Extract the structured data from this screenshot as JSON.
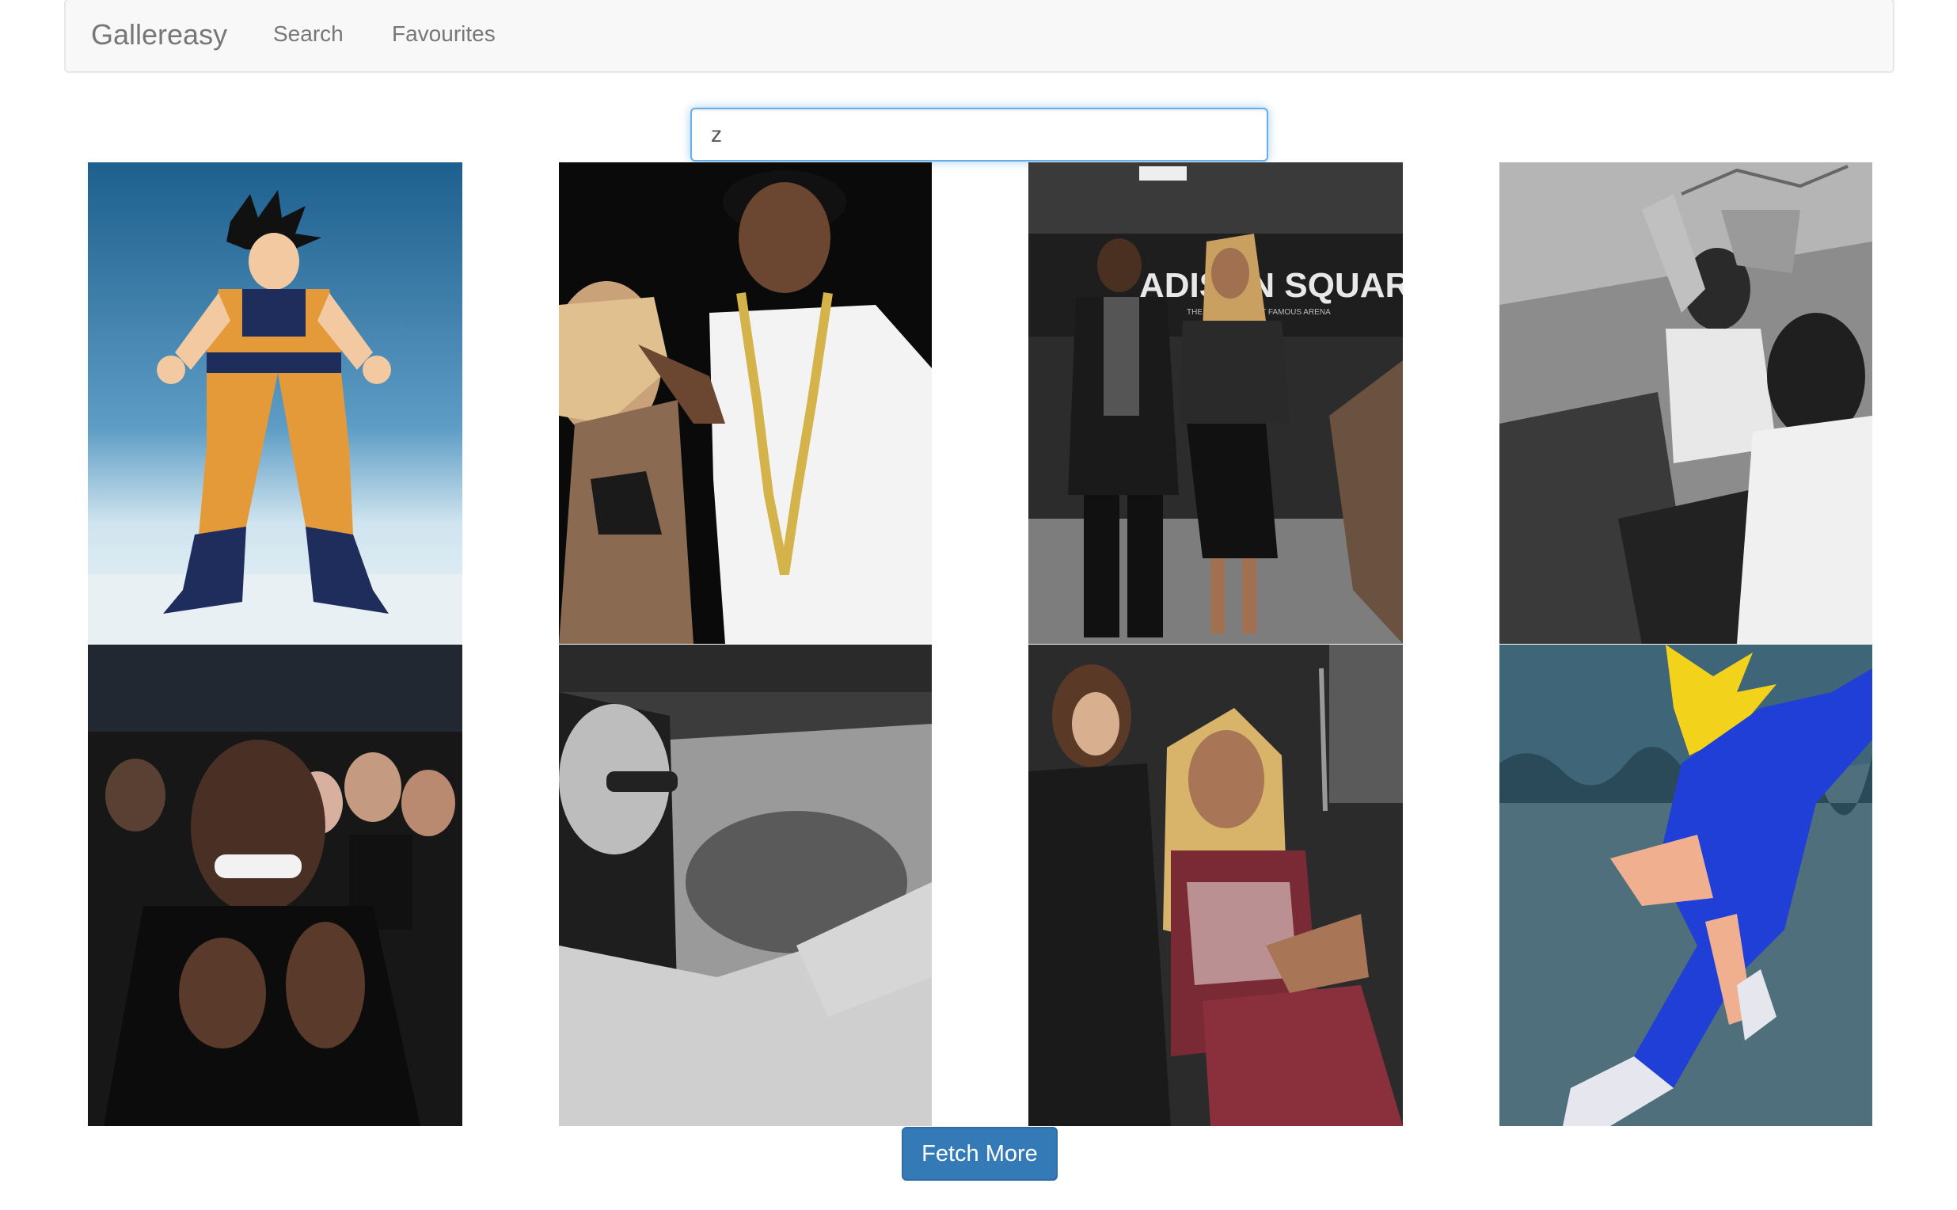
{
  "navbar": {
    "brand": "Gallereasy",
    "links": [
      {
        "label": "Search"
      },
      {
        "label": "Favourites"
      }
    ]
  },
  "search": {
    "value": "z"
  },
  "gallery": {
    "items": [
      {
        "subject": "anime fighter powering up"
      },
      {
        "subject": "man with gold chain and dancing woman"
      },
      {
        "subject": "couple in arena tunnel"
      },
      {
        "subject": "men laughing in car (black and white)"
      },
      {
        "subject": "man clapping in audience"
      },
      {
        "subject": "man waving from car window (black and white)"
      },
      {
        "subject": "woman courtside"
      },
      {
        "subject": "anime character flying"
      }
    ],
    "arena_sign": "ADISON SQUARE GARDEN",
    "arena_sign_sub": "THE WORLD'S MOST FAMOUS ARENA"
  },
  "fetch_button": {
    "label": "Fetch More"
  },
  "colors": {
    "primary": "#337ab7",
    "navbar_bg": "#f8f8f8",
    "nav_text": "#777777",
    "focus": "#66afe9"
  }
}
